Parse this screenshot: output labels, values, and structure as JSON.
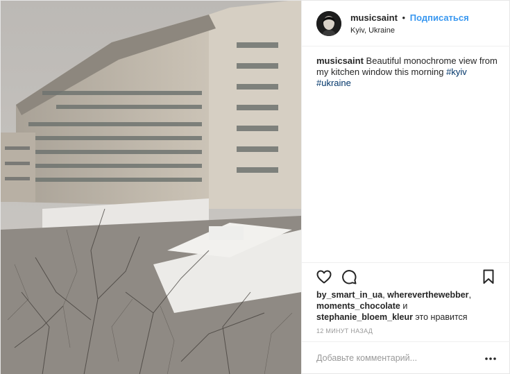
{
  "post": {
    "username": "musicsaint",
    "separator": "•",
    "follow_label": "Подписаться",
    "location": "Kyiv, Ukraine",
    "caption": {
      "username": "musicsaint",
      "text": " Beautiful monochrome view from my kitchen window this morning ",
      "hashtags": [
        "#kyiv",
        "#ukraine"
      ]
    },
    "likes": {
      "user1": "by_smart_in_ua",
      "sep1": ", ",
      "user2": "whereverthewebber",
      "sep2": ",",
      "user3": "moments_chocolate",
      "and": " и",
      "user4": "stephanie_bloem_kleur",
      "suffix": " это нравится"
    },
    "timestamp": "12 МИНУТ НАЗАД",
    "comment_placeholder": "Добавьте комментарий...",
    "icons": {
      "like": "heart-icon",
      "comment": "comment-icon",
      "save": "bookmark-icon",
      "more": "more-options-icon"
    },
    "colors": {
      "link": "#3897f0",
      "hashtag": "#003569",
      "muted": "#999999",
      "text": "#262626"
    }
  }
}
